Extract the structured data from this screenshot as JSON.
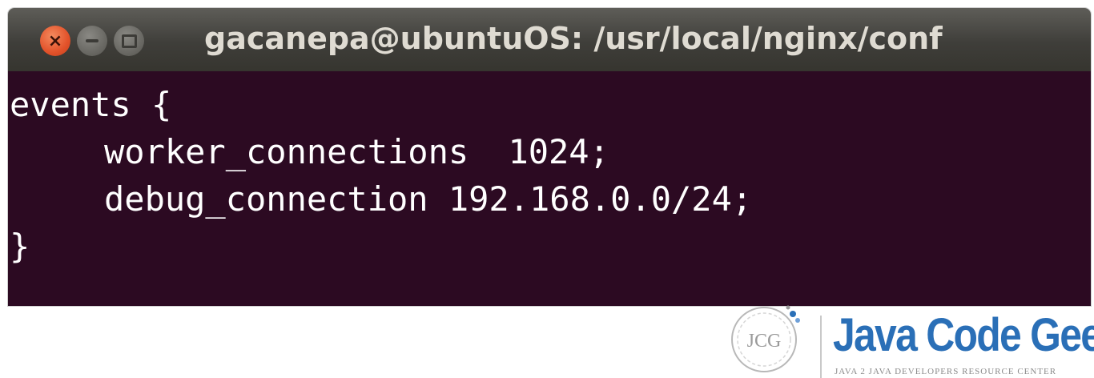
{
  "window": {
    "title": "gacanepa@ubuntuOS: /usr/local/nginx/conf",
    "controls": {
      "close_icon": "close-icon",
      "close_glyph": "×",
      "minimize_icon": "minimize-icon",
      "maximize_icon": "maximize-icon"
    }
  },
  "terminal": {
    "lines": [
      "events {",
      "worker_connections",
      "1024;",
      "debug_connection 192.168.0.0/24;",
      "}"
    ]
  },
  "watermark": {
    "badge_text": "JCG",
    "brand_name": "Java Code Geeks",
    "tagline": "Java 2 Java Developers Resource Center"
  },
  "colors": {
    "terminal_bg": "#2c0a22",
    "titlebar_bg": "#3f3e3a",
    "close_button": "#e2522a",
    "brand_blue": "#2a6fb7"
  }
}
